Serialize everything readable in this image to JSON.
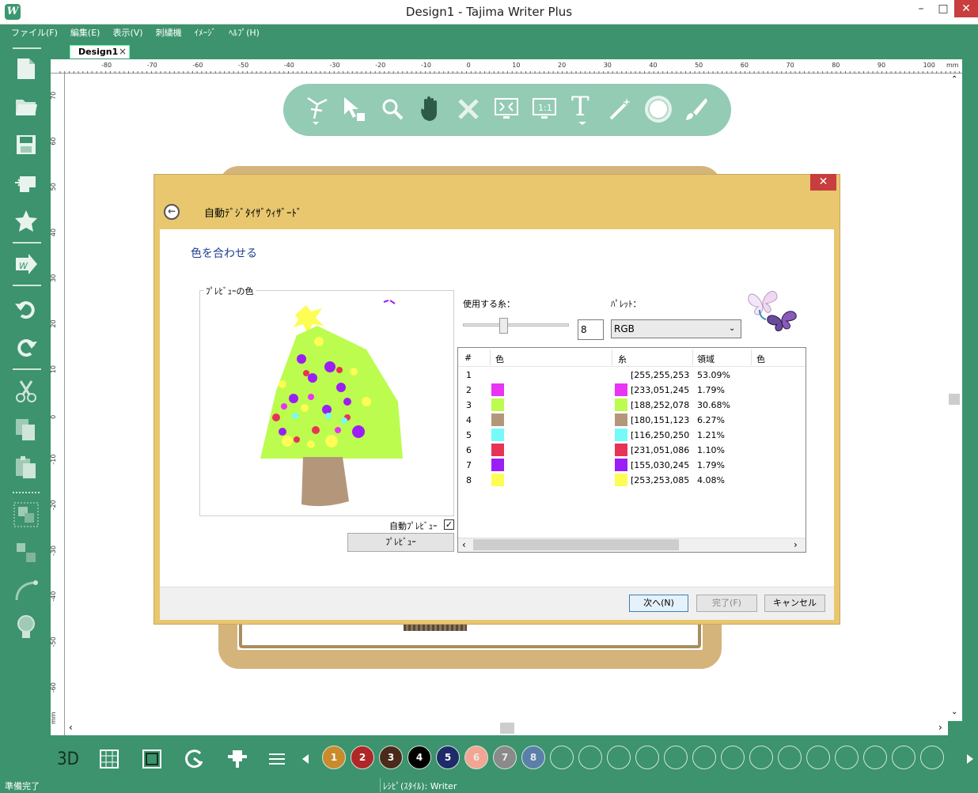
{
  "window": {
    "title": "Design1 - Tajima Writer Plus",
    "logo": "W"
  },
  "menu": [
    "ファイル(F)",
    "編集(E)",
    "表示(V)",
    "刺繍機",
    "ｲﾒｰｼﾞ",
    "ﾍﾙﾌﾟ(H)"
  ],
  "tab": {
    "label": "Design1",
    "close": "×"
  },
  "ruler": {
    "top": [
      "-80",
      "-70",
      "-60",
      "-50",
      "-40",
      "-30",
      "-20",
      "-10",
      "0",
      "10",
      "20",
      "30",
      "40",
      "50",
      "60",
      "70",
      "80",
      "90",
      "100",
      "mm"
    ],
    "left": [
      "70",
      "60",
      "50",
      "40",
      "30",
      "20",
      "10",
      "0",
      "-10",
      "-20",
      "-30",
      "-40",
      "-50",
      "-60",
      "mm"
    ]
  },
  "dialog": {
    "title": "自動ﾃﾞｼﾞﾀｲｻﾞｳｨｻﾞｰﾄﾞ",
    "close": "✕",
    "back": "←",
    "step_title": "色を合わせる",
    "preview_label": "ﾌﾟﾚﾋﾞｭｰの色",
    "auto_preview": "自動ﾌﾟﾚﾋﾞｭｰ",
    "auto_check": "✓",
    "preview_button": "ﾌﾟﾚﾋﾞｭｰ",
    "thread_label": "使用する糸：",
    "palette_label": "ﾊﾟﾚｯﾄ：",
    "thread_count": "8",
    "slider_value": 0.37,
    "palette_value": "RGB",
    "columns": [
      "#",
      "色",
      "糸",
      "領域",
      "色"
    ],
    "rows": [
      {
        "n": "1",
        "color": "#fdfdfd",
        "thread": "[255,255,253",
        "area": "53.09%"
      },
      {
        "n": "2",
        "color": "#e933f5",
        "thread": "[233,051,245",
        "area": "1.79%"
      },
      {
        "n": "3",
        "color": "#bcfc4e",
        "thread": "[188,252,078",
        "area": "30.68%"
      },
      {
        "n": "4",
        "color": "#b4977b",
        "thread": "[180,151,123",
        "area": "6.27%"
      },
      {
        "n": "5",
        "color": "#74fafa",
        "thread": "[116,250,250",
        "area": "1.21%"
      },
      {
        "n": "6",
        "color": "#e73356",
        "thread": "[231,051,086",
        "area": "1.10%"
      },
      {
        "n": "7",
        "color": "#9b1ef5",
        "thread": "[155,030,245",
        "area": "1.79%"
      },
      {
        "n": "8",
        "color": "#fdfd55",
        "thread": "[253,253,085",
        "area": "4.08%"
      }
    ],
    "buttons": {
      "next": "次へ(N)",
      "finish": "完了(F)",
      "cancel": "キャンセル"
    }
  },
  "bottom": {
    "label_3d": "3D",
    "colors": [
      {
        "n": "1",
        "c": "#c98b2c"
      },
      {
        "n": "2",
        "c": "#b02727"
      },
      {
        "n": "3",
        "c": "#4a2a18"
      },
      {
        "n": "4",
        "c": "#000000"
      },
      {
        "n": "5",
        "c": "#1e2b68"
      },
      {
        "n": "6",
        "c": "#f2a593"
      },
      {
        "n": "7",
        "c": "#8a8a8a"
      },
      {
        "n": "8",
        "c": "#5a7fa8"
      }
    ]
  },
  "status": {
    "left": "準備完了",
    "mid": "ﾚｼﾋﾟ(ｽﾀｲﾙ): Writer"
  }
}
